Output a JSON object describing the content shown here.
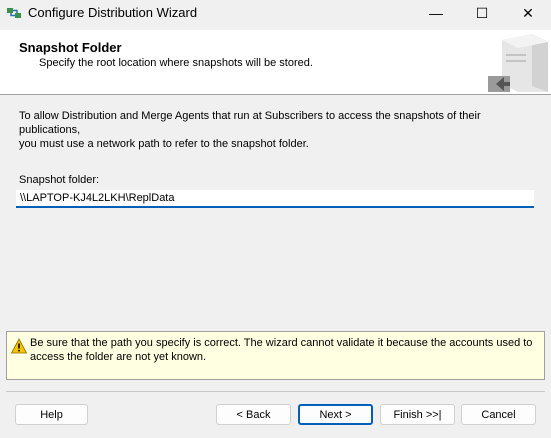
{
  "window": {
    "title": "Configure Distribution Wizard",
    "minimize_glyph": "—",
    "maximize_glyph": "☐",
    "close_glyph": "✕"
  },
  "header": {
    "title": "Snapshot Folder",
    "subtitle": "Specify the root location where snapshots will be stored."
  },
  "body": {
    "intro_line1": "To allow Distribution and Merge Agents that run at Subscribers to access the snapshots of their publications,",
    "intro_line2": "you must use a network path to refer to the snapshot folder.",
    "folder_label": "Snapshot folder:",
    "folder_value": "\\\\LAPTOP-KJ4L2LKH\\ReplData"
  },
  "warning": {
    "line1": "Be sure that the path you specify is correct. The wizard cannot validate it because the accounts used to",
    "line2": "access the folder are not yet known.",
    "icon": "warning-icon"
  },
  "buttons": {
    "help": "Help",
    "back": "< Back",
    "next": "Next >",
    "finish": "Finish >>|",
    "cancel": "Cancel"
  },
  "colors": {
    "accent": "#005fb8",
    "warning_bg": "#ffffe1"
  }
}
